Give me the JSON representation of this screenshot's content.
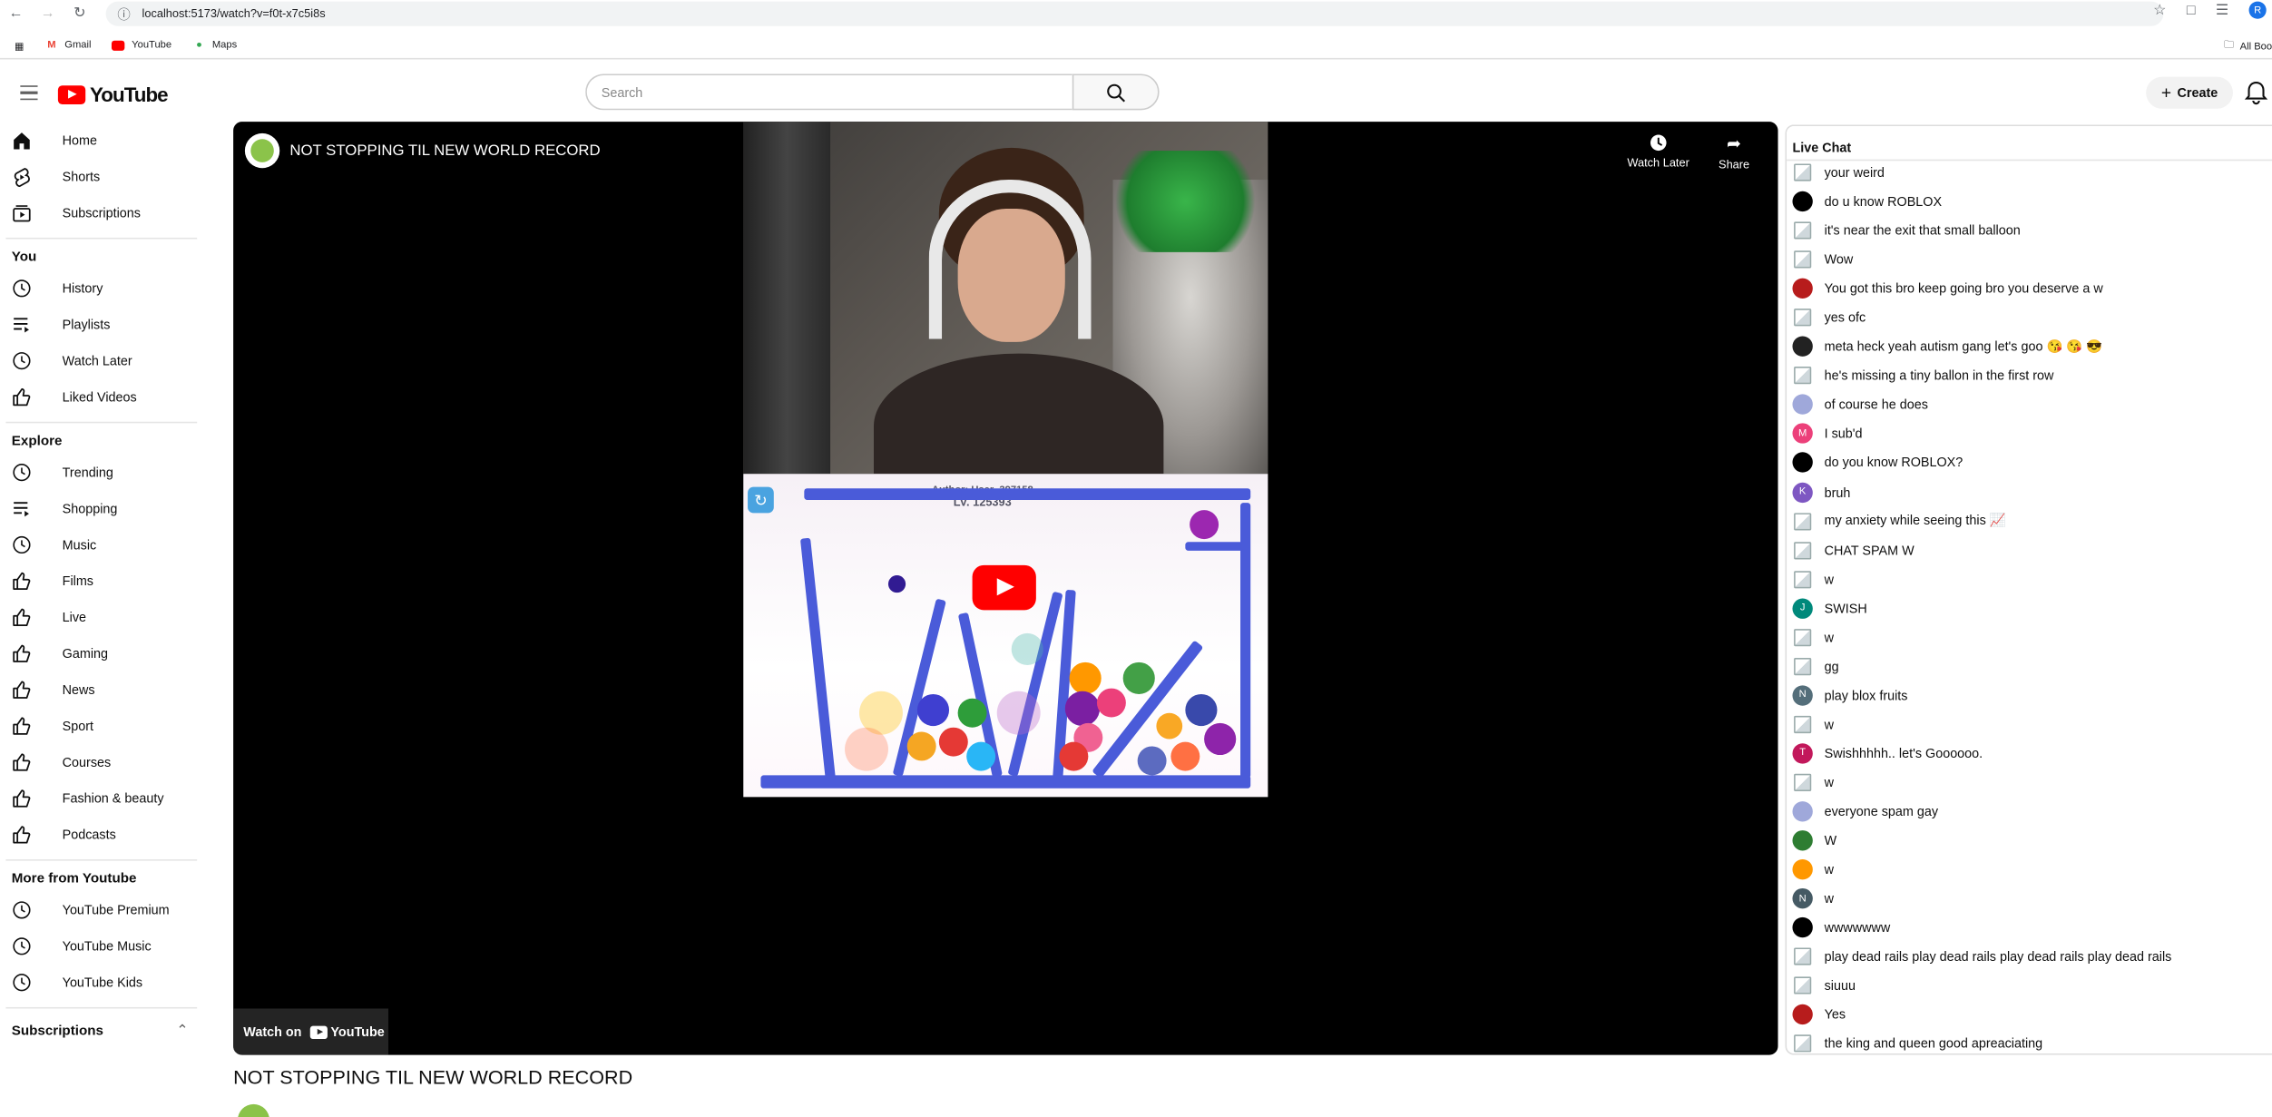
{
  "browser": {
    "url": "localhost:5173/watch?v=f0t-x7c5i8s",
    "bookmarks": [
      "Gmail",
      "YouTube",
      "Maps"
    ],
    "all_bookmarks": "All Boo"
  },
  "header": {
    "logo_text": "YouTube",
    "search_placeholder": "Search",
    "create_label": "Create"
  },
  "sidebar": {
    "main": [
      {
        "label": "Home",
        "icon": "home-icon"
      },
      {
        "label": "Shorts",
        "icon": "shorts-icon"
      },
      {
        "label": "Subscriptions",
        "icon": "subscriptions-icon"
      }
    ],
    "you_title": "You",
    "you": [
      {
        "label": "History",
        "icon": "history-icon"
      },
      {
        "label": "Playlists",
        "icon": "playlist-icon"
      },
      {
        "label": "Watch Later",
        "icon": "clock-icon"
      },
      {
        "label": "Liked Videos",
        "icon": "thumbs-up-icon"
      }
    ],
    "explore_title": "Explore",
    "explore": [
      {
        "label": "Trending",
        "icon": "clock-icon"
      },
      {
        "label": "Shopping",
        "icon": "playlist-icon"
      },
      {
        "label": "Music",
        "icon": "clock-icon"
      },
      {
        "label": "Films",
        "icon": "thumbs-up-icon"
      },
      {
        "label": "Live",
        "icon": "thumbs-up-icon"
      },
      {
        "label": "Gaming",
        "icon": "thumbs-up-icon"
      },
      {
        "label": "News",
        "icon": "thumbs-up-icon"
      },
      {
        "label": "Sport",
        "icon": "thumbs-up-icon"
      },
      {
        "label": "Courses",
        "icon": "thumbs-up-icon"
      },
      {
        "label": "Fashion & beauty",
        "icon": "thumbs-up-icon"
      },
      {
        "label": "Podcasts",
        "icon": "thumbs-up-icon"
      }
    ],
    "more_title": "More from Youtube",
    "more": [
      {
        "label": "YouTube Premium",
        "icon": "clock-icon"
      },
      {
        "label": "YouTube Music",
        "icon": "clock-icon"
      },
      {
        "label": "YouTube Kids",
        "icon": "clock-icon"
      }
    ],
    "subs_title": "Subscriptions"
  },
  "player": {
    "title": "NOT STOPPING TIL NEW WORLD RECORD",
    "watch_later": "Watch Later",
    "share": "Share",
    "watch_on": "Watch on",
    "watch_on_brand": "YouTube",
    "game_author": "Author: User_397158",
    "game_level": "LV. 125393"
  },
  "video": {
    "title": "NOT STOPPING TIL NEW WORLD RECORD"
  },
  "chat": {
    "title": "Live Chat",
    "messages": [
      {
        "text": "your weird",
        "av": "img",
        "color": "",
        "letter": ""
      },
      {
        "text": "do u know ROBLOX",
        "av": "solid",
        "color": "#000000",
        "letter": ""
      },
      {
        "text": "it's near the exit that small balloon",
        "av": "img",
        "color": "",
        "letter": ""
      },
      {
        "text": "Wow",
        "av": "img",
        "color": "",
        "letter": ""
      },
      {
        "text": "You got this bro keep going bro you deserve a w",
        "av": "solid",
        "color": "#b71c1c",
        "letter": ""
      },
      {
        "text": "yes ofc",
        "av": "img",
        "color": "",
        "letter": ""
      },
      {
        "text": "meta heck yeah autism gang let's goo 😘 😘 😎",
        "av": "solid",
        "color": "#222222",
        "letter": ""
      },
      {
        "text": "he's missing a tiny ballon in the first row",
        "av": "img",
        "color": "",
        "letter": ""
      },
      {
        "text": "of course he does",
        "av": "solid",
        "color": "#9fa8da",
        "letter": ""
      },
      {
        "text": "I sub'd",
        "av": "solid",
        "color": "#ec407a",
        "letter": "M"
      },
      {
        "text": "do you know ROBLOX?",
        "av": "solid",
        "color": "#000000",
        "letter": ""
      },
      {
        "text": "bruh",
        "av": "solid",
        "color": "#7e57c2",
        "letter": "K"
      },
      {
        "text": "my anxiety while seeing this 📈",
        "av": "img",
        "color": "",
        "letter": ""
      },
      {
        "text": "CHAT SPAM W",
        "av": "img",
        "color": "",
        "letter": ""
      },
      {
        "text": "w",
        "av": "img",
        "color": "",
        "letter": ""
      },
      {
        "text": "SWISH",
        "av": "solid",
        "color": "#00897b",
        "letter": "J"
      },
      {
        "text": "w",
        "av": "img",
        "color": "",
        "letter": ""
      },
      {
        "text": "gg",
        "av": "img",
        "color": "",
        "letter": ""
      },
      {
        "text": "play blox fruits",
        "av": "solid",
        "color": "#546e7a",
        "letter": "N"
      },
      {
        "text": "w",
        "av": "img",
        "color": "",
        "letter": ""
      },
      {
        "text": "Swishhhhh.. let's Goooooo.",
        "av": "solid",
        "color": "#c2185b",
        "letter": "T"
      },
      {
        "text": "w",
        "av": "img",
        "color": "",
        "letter": ""
      },
      {
        "text": "everyone spam gay",
        "av": "solid",
        "color": "#9fa8da",
        "letter": ""
      },
      {
        "text": "W",
        "av": "solid",
        "color": "#2e7d32",
        "letter": ""
      },
      {
        "text": "w",
        "av": "solid",
        "color": "#ff9800",
        "letter": ""
      },
      {
        "text": "w",
        "av": "solid",
        "color": "#455a64",
        "letter": "N"
      },
      {
        "text": "wwwwwww",
        "av": "solid",
        "color": "#000000",
        "letter": ""
      },
      {
        "text": "play dead rails play dead rails play dead rails play dead rails",
        "av": "img",
        "color": "",
        "letter": ""
      },
      {
        "text": "siuuu",
        "av": "img",
        "color": "",
        "letter": ""
      },
      {
        "text": "Yes",
        "av": "solid",
        "color": "#b71c1c",
        "letter": ""
      },
      {
        "text": "the king and queen good apreaciating",
        "av": "img",
        "color": "",
        "letter": ""
      }
    ]
  },
  "colors": {
    "brand_red": "#ff0000",
    "game_bar": "#4a5bd9"
  }
}
